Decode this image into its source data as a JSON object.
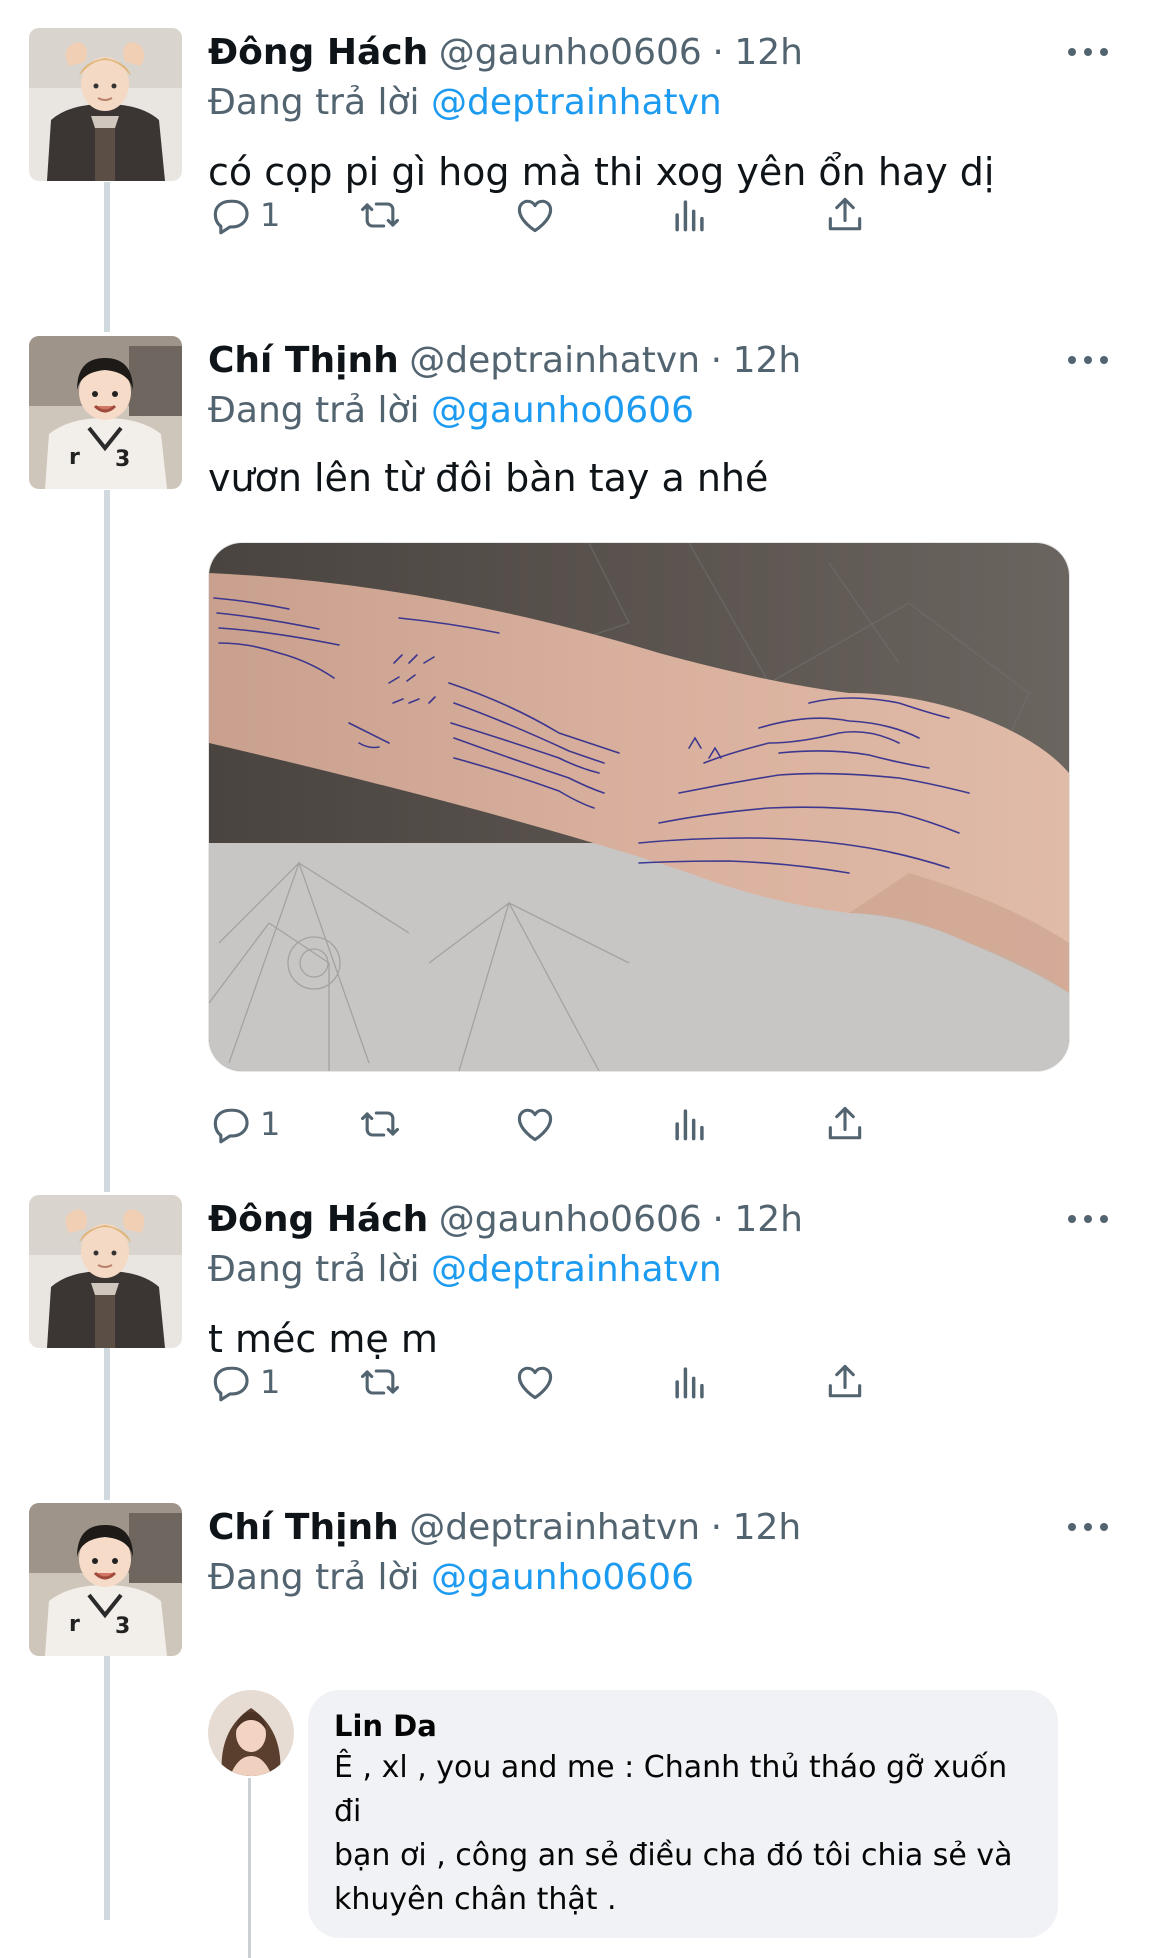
{
  "tweets": [
    {
      "name": "Đông Hách",
      "handle": "@gaunho0606",
      "dot": "·",
      "time": "12h",
      "reply_prefix": "Đang trả lời",
      "reply_to": "@deptrainhatvn",
      "text": "có cọp pi gì hog mà thi xog yên ổn hay dị",
      "reply_count": "1"
    },
    {
      "name": "Chí Thịnh",
      "handle": "@deptrainhatvn",
      "dot": "·",
      "time": "12h",
      "reply_prefix": "Đang trả lời",
      "reply_to": "@gaunho0606",
      "text": "vươn lên từ đôi bàn tay a nhé",
      "reply_count": "1"
    },
    {
      "name": "Đông Hách",
      "handle": "@gaunho0606",
      "dot": "·",
      "time": "12h",
      "reply_prefix": "Đang trả lời",
      "reply_to": "@deptrainhatvn",
      "text": "t méc mẹ m",
      "reply_count": "1"
    },
    {
      "name": "Chí Thịnh",
      "handle": "@deptrainhatvn",
      "dot": "·",
      "time": "12h",
      "reply_prefix": "Đang trả lời",
      "reply_to": "@gaunho0606"
    }
  ],
  "embedded_comment": {
    "name": "Lin Da",
    "lines": [
      "Ê , xl , you and me : Chanh thủ tháo gỡ xuốn đi",
      "bạn ơi , công an sẻ điều cha đó tôi chia sẻ và",
      "khuyên chân thật ."
    ]
  },
  "icons": {
    "reply": "reply-icon",
    "retweet": "retweet-icon",
    "like": "like-icon",
    "analytics": "analytics-icon",
    "share": "share-icon",
    "more": "more-icon"
  },
  "colors": {
    "link": "#1d9bf0",
    "muted": "#536471",
    "thread_line": "#cfd9de",
    "ink": "#2c2a8e"
  }
}
